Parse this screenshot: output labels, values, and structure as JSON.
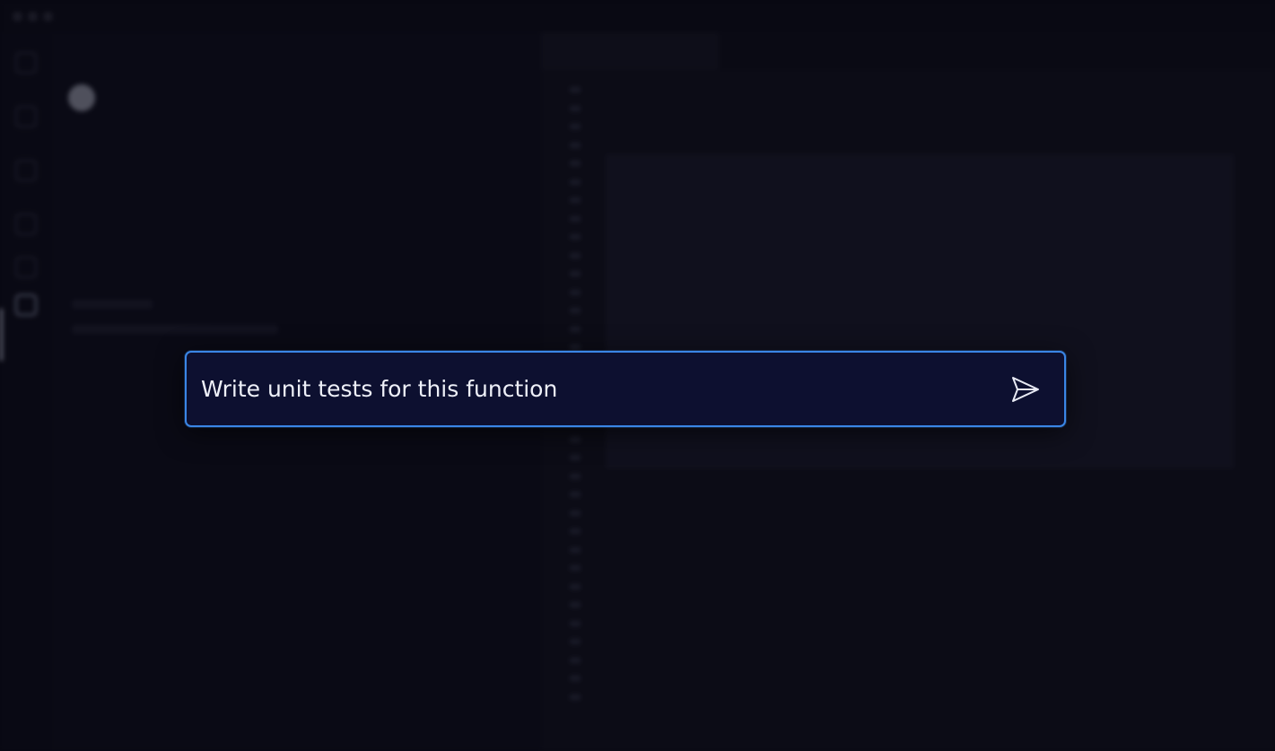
{
  "prompt": {
    "text": "Write unit tests for this function"
  },
  "icons": {
    "send": "send-icon"
  },
  "colors": {
    "prompt_border": "#3a86e6",
    "prompt_background": "#0d1030"
  }
}
